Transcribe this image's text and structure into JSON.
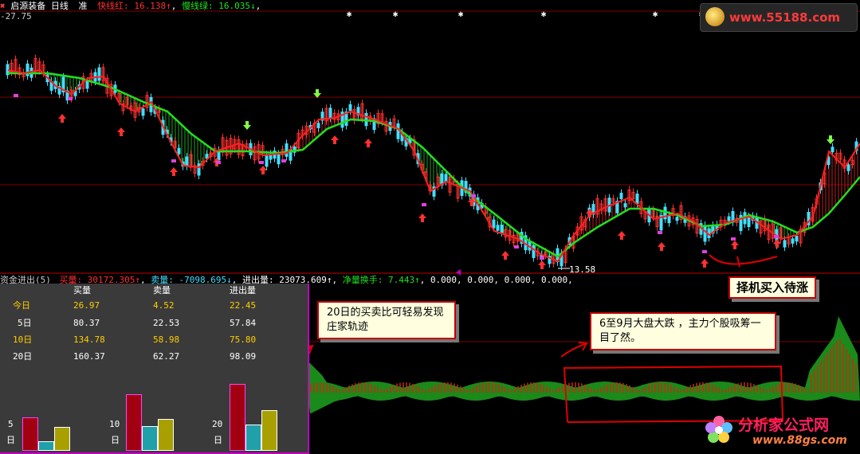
{
  "header": {
    "title": "启源装备",
    "period": "日线",
    "flag": "准",
    "fast_line": "快线红: 16.138↑",
    "slow_line": "慢线绿: 16.035↓"
  },
  "price_axis": {
    "top_value": "27.75",
    "low_marker": "13.58"
  },
  "indicator": {
    "name": "资金进出(5)",
    "buy": "买量: 30172.305↑",
    "sell": "卖量: -7098.695↓",
    "net_in_out": "进出量: 23073.609↑",
    "net_turnover": "净量换手: 7.443↑",
    "extra": "0.000, 0.000, 0.000, 0.000,"
  },
  "stats": {
    "headers": [
      "买量",
      "卖量",
      "进出量"
    ],
    "rows": [
      {
        "label": "今日",
        "buy": "26.97",
        "sell": "4.52",
        "net": "22.45",
        "color": "#ffcc00"
      },
      {
        "label": "5日",
        "buy": "80.37",
        "sell": "22.53",
        "net": "57.84",
        "color": "#ffffff"
      },
      {
        "label": "10日",
        "buy": "134.78",
        "sell": "58.98",
        "net": "75.80",
        "color": "#ffcc00"
      },
      {
        "label": "20日",
        "buy": "160.37",
        "sell": "62.27",
        "net": "98.09",
        "color": "#ffffff"
      }
    ],
    "bar_groups": [
      {
        "label_num": "5",
        "label_unit": "日",
        "buy": 80.37,
        "sell": 22.53,
        "net": 57.84
      },
      {
        "label_num": "10",
        "label_unit": "日",
        "buy": 134.78,
        "sell": 58.98,
        "net": 75.8
      },
      {
        "label_num": "20",
        "label_unit": "日",
        "buy": 160.37,
        "sell": 62.27,
        "net": 98.09
      }
    ],
    "bar_colors": {
      "buy": "#a00010",
      "sell": "#20a0a8",
      "net": "#a8a000"
    }
  },
  "annotations": {
    "box1": "20日的买卖比可轻易发现庄家轨迹",
    "box2": "6至9月大盘大跌 ，主力个股吸筹一目了然。",
    "box3": "择机买入待涨"
  },
  "watermarks": {
    "top": "www.55188.com",
    "bottom_cn": "分析家公式网",
    "bottom_url": "www.88gs.com"
  },
  "colors": {
    "fast": "#ff2020",
    "slow": "#20e020",
    "up_candle": "#ff3030",
    "down_candle": "#40e0ff",
    "grid": "#800000"
  }
}
